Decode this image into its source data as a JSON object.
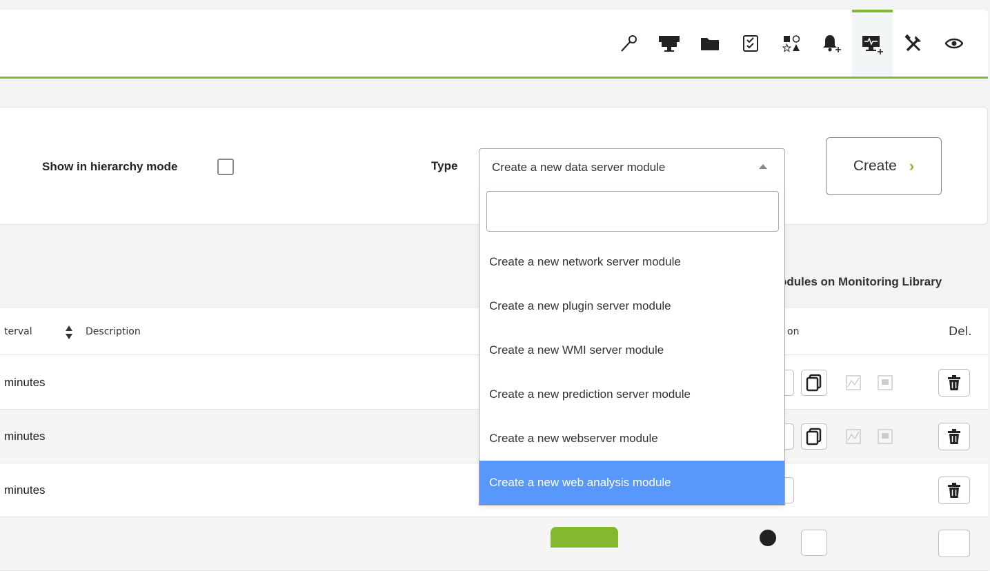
{
  "toolbar": {
    "tabs": [
      {
        "icon": "key-icon"
      },
      {
        "icon": "agents-monitor-icon"
      },
      {
        "icon": "folder-icon"
      },
      {
        "icon": "checklist-icon"
      },
      {
        "icon": "shapes-icon"
      },
      {
        "icon": "bell-plus-icon"
      },
      {
        "icon": "module-monitor-plus-icon",
        "active": true
      },
      {
        "icon": "tools-icon"
      },
      {
        "icon": "eye-icon"
      }
    ],
    "accent_color": "#82b92e"
  },
  "filter": {
    "hierarchy_label": "Show in hierarchy mode",
    "hierarchy_checked": false,
    "type_label": "Type",
    "type_selected": "Create a new data server module",
    "create_label": "Create",
    "create_arrow": "›"
  },
  "dropdown": {
    "search_value": "",
    "options": [
      "Create a new network server module",
      "Create a new plugin server module",
      "Create a new WMI server module",
      "Create a new prediction server module",
      "Create a new webserver module",
      "Create a new web analysis module"
    ],
    "highlighted_index": 5,
    "highlight_color": "#5897fb"
  },
  "library_text": "odules on Monitoring Library",
  "table": {
    "columns": {
      "interval": "terval",
      "description": "Description",
      "action": "on",
      "delete": "Del."
    },
    "rows": [
      {
        "interval": "minutes"
      },
      {
        "interval": "minutes"
      },
      {
        "interval": "minutes"
      }
    ]
  }
}
